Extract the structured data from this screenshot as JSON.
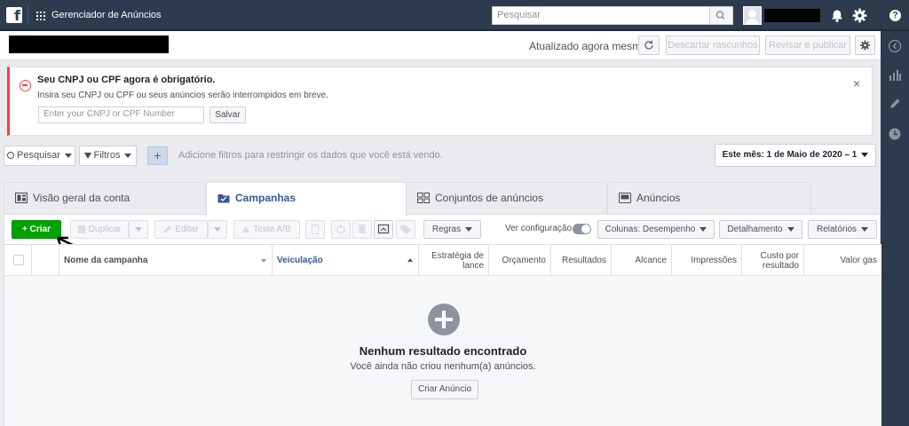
{
  "topbar": {
    "app_title": "Gerenciador de Anúncios",
    "search_placeholder": "Pesquisar"
  },
  "subheader": {
    "status": "Atualizado agora mesmo",
    "discard_label": "Descartar rascunhos",
    "review_label": "Revisar e publicar"
  },
  "alert": {
    "title": "Seu CNPJ ou CPF agora é obrigatório.",
    "text": "Insira seu CNPJ ou CPF ou seus anúncios serão interrompidos em breve.",
    "input_placeholder": "Enter your CNPJ or CPF Number",
    "save_label": "Salvar",
    "close": "×"
  },
  "filterbar": {
    "search_label": "Pesquisar",
    "filters_label": "Filtros",
    "add_label": "+",
    "placeholder": "Adicione filtros para restringir os dados que você está vendo.",
    "date_range": "Este mês: 1 de Maio de 2020 – 1"
  },
  "tabs": [
    {
      "label": "Visão geral da conta"
    },
    {
      "label": "Campanhas"
    },
    {
      "label": "Conjuntos de anúncios"
    },
    {
      "label": "Anúncios"
    }
  ],
  "toolbar": {
    "create": "+ Criar",
    "duplicate": "Duplicar",
    "edit": "Editar",
    "ab_test": "Teste A/B",
    "rules": "Regras",
    "view_config": "Ver configuração",
    "columns": "Colunas: Desempenho",
    "breakdown": "Detalhamento",
    "reports": "Relatórios"
  },
  "table": {
    "headers": {
      "name": "Nome da campanha",
      "delivery": "Veiculação",
      "bid_strategy": "Estratégia de lance",
      "budget": "Orçamento",
      "results": "Resultados",
      "reach": "Alcance",
      "impressions": "Impressões",
      "cost_per_result": "Custo por resultado",
      "amount_spent": "Valor gas"
    }
  },
  "empty_state": {
    "title": "Nenhum resultado encontrado",
    "subtitle": "Você ainda não criou nenhum(a) anúncios.",
    "button": "Criar Anúncio"
  },
  "colors": {
    "topbar": "#2e3b4e",
    "create_green": "#00a400",
    "alert_red": "#fa3e3e",
    "link_blue": "#365899"
  }
}
